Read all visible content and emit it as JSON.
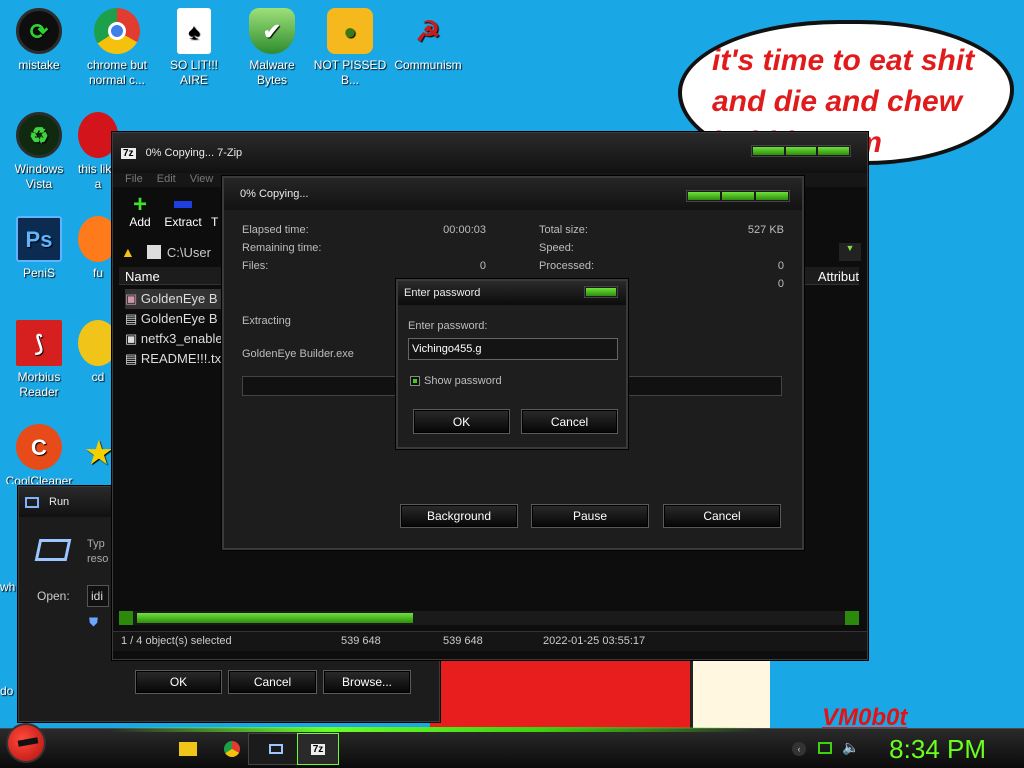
{
  "wallpaper": {
    "speech_bubble": "it's time to eat shit and die and chew bubble gum",
    "signature": "VM0b0t"
  },
  "desktop_icons": [
    {
      "label": "mistake",
      "icon": "mistake-icon"
    },
    {
      "label": "chrome but normal c...",
      "icon": "chrome-icon"
    },
    {
      "label": "SO LIT!!! AIRE",
      "icon": "solitaire-icon"
    },
    {
      "label": "Malware Bytes",
      "icon": "shield-check-icon"
    },
    {
      "label": "NOT PISSED B...",
      "icon": "bad-piggies-icon"
    },
    {
      "label": "Communism",
      "icon": "communism-icon"
    },
    {
      "label": "Windows Vista",
      "icon": "vista-icon"
    },
    {
      "label": "this like a",
      "icon": "opera-icon"
    },
    {
      "label": "PeniS",
      "icon": "photoshop-icon"
    },
    {
      "label": "fu",
      "icon": "firefox-icon"
    },
    {
      "label": "Morbius Reader",
      "icon": "pdf-reader-icon"
    },
    {
      "label": "cd",
      "icon": "disc-icon"
    },
    {
      "label": "CoolCleaner",
      "icon": "ccleaner-icon"
    },
    {
      "label": "wh",
      "icon": "unknown-icon"
    },
    {
      "label": "do",
      "icon": "unknown-icon"
    }
  ],
  "run_dialog": {
    "title": "Run",
    "description": "Typ reso",
    "open_label": "Open:",
    "open_value": "idi",
    "ok": "OK",
    "cancel": "Cancel",
    "browse": "Browse..."
  },
  "zip_window": {
    "title": "0% Copying... 7-Zip",
    "menu": [
      "File",
      "Edit",
      "View"
    ],
    "toolbar": [
      "Add",
      "Extract",
      "T"
    ],
    "path": "C:\\User",
    "columns": [
      "Name",
      "Attribut"
    ],
    "files": [
      "GoldenEye B",
      "GoldenEye B",
      "netfx3_enable",
      "README!!!.tx"
    ],
    "status": [
      "1 / 4 object(s) selected",
      "539 648",
      "539 648",
      "2022-01-25 03:55:17"
    ]
  },
  "progress_dialog": {
    "title": "0% Copying...",
    "elapsed_label": "Elapsed time:",
    "elapsed_value": "00:00:03",
    "remaining_label": "Remaining time:",
    "files_label": "Files:",
    "files_value": "0",
    "total_label": "Total size:",
    "total_value": "527 KB",
    "speed_label": "Speed:",
    "processed_label": "Processed:",
    "processed_value": "0",
    "extra_value": "0",
    "extracting_label": "Extracting",
    "current_file": "GoldenEye Builder.exe",
    "progress": 0,
    "background": "Background",
    "pause": "Pause",
    "cancel": "Cancel"
  },
  "password_dialog": {
    "title": "Enter password",
    "prompt": "Enter password:",
    "value": "Vichingo455.g",
    "show_password": "Show password",
    "show_checked": true,
    "ok": "OK",
    "cancel": "Cancel"
  },
  "taskbar": {
    "clock": "8:34 PM",
    "pinned": [
      "explorer-icon",
      "chrome-icon",
      "run-icon",
      "7zip-icon"
    ]
  }
}
